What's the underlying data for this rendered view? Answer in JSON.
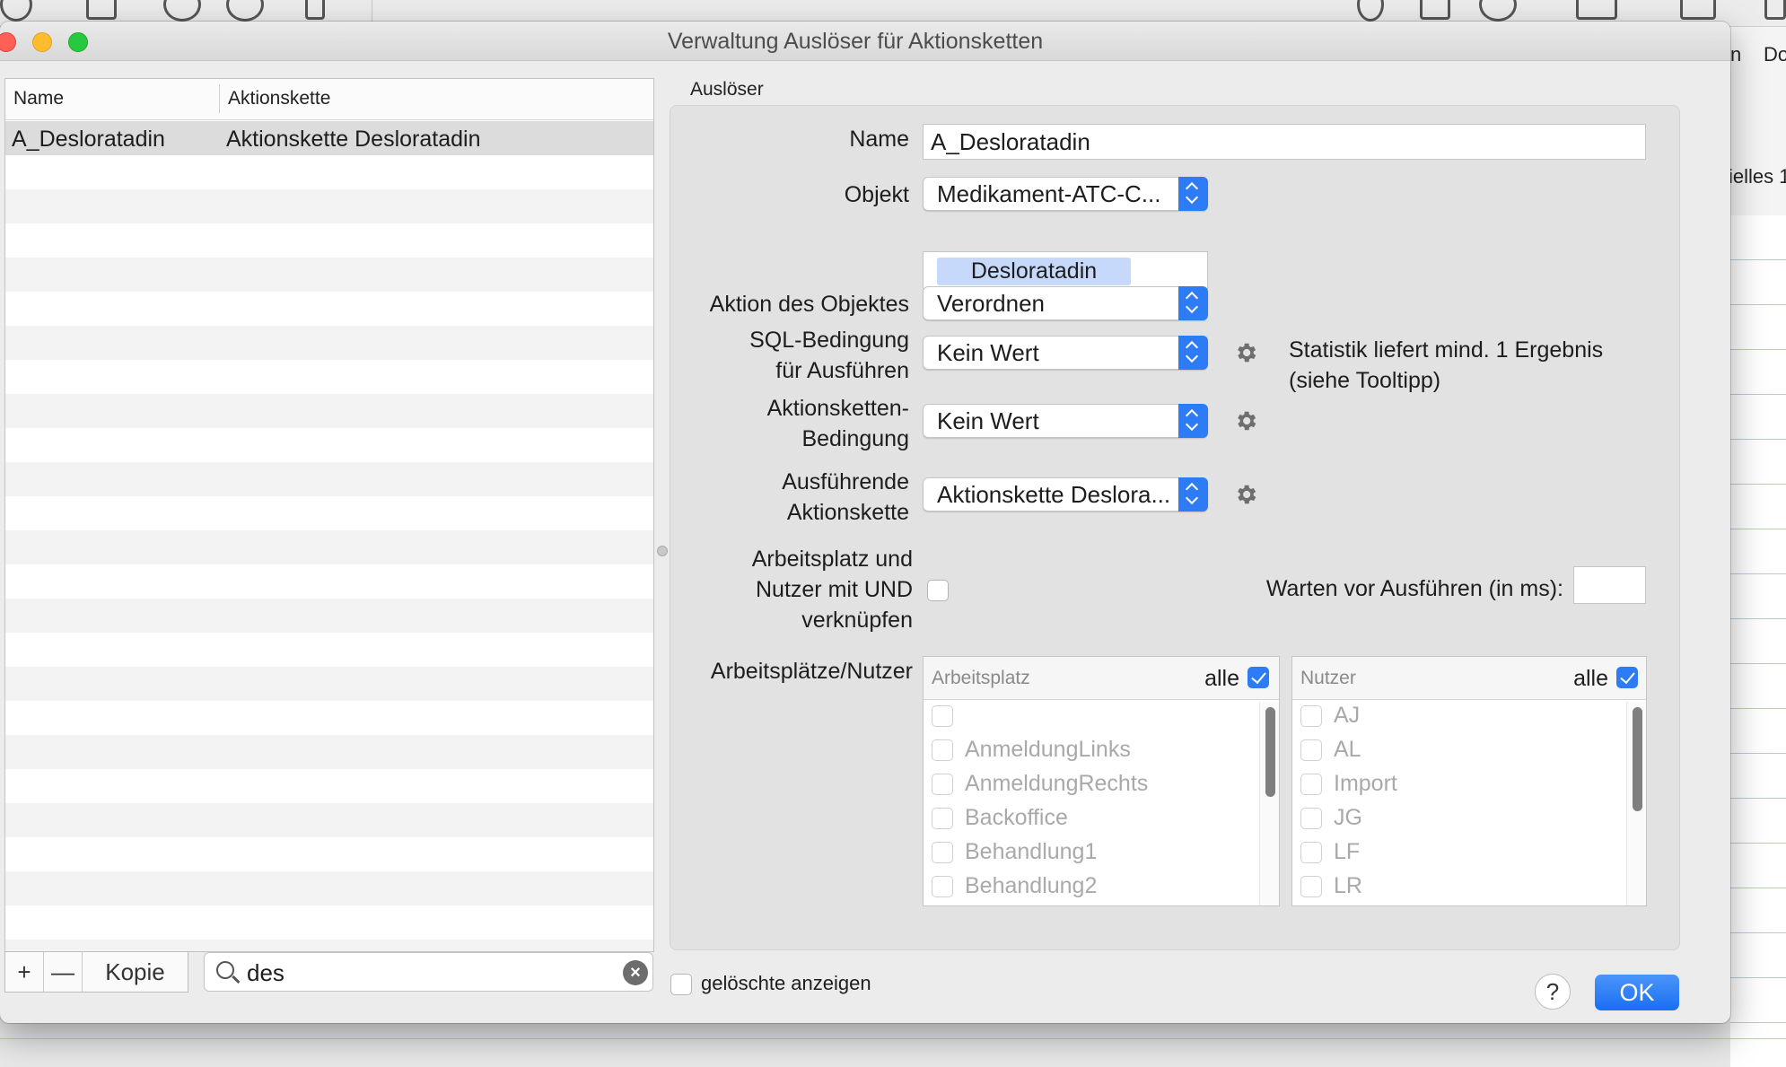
{
  "background_app": {
    "right_labels": [
      "n",
      "Do"
    ],
    "partial_label": "ielles 1"
  },
  "window": {
    "title": "Verwaltung Auslöser für Aktionsketten"
  },
  "table": {
    "columns": [
      "Name",
      "Aktionskette"
    ],
    "rows": [
      {
        "name": "A_Desloratadin",
        "chain": "Aktionskette Desloratadin",
        "selected": true
      }
    ]
  },
  "bottom_bar": {
    "add_label": "+",
    "remove_label": "—",
    "copy_label": "Kopie",
    "search_value": "des",
    "show_deleted_label": "gelöschte anzeigen",
    "show_deleted_checked": false,
    "help_label": "?",
    "ok_label": "OK"
  },
  "trigger": {
    "group_title": "Auslöser",
    "name_label": "Name",
    "name_value": "A_Desloratadin",
    "object_label": "Objekt",
    "object_value": "Medikament-ATC-C...",
    "object_token": "Desloratadin",
    "action_label": "Aktion des Objektes",
    "action_value": "Verordnen",
    "sql_label_line1": "SQL-Bedingung",
    "sql_label_line2": "für Ausführen",
    "sql_value": "Kein Wert",
    "sql_hint_line1": "Statistik liefert mind. 1 Ergebnis",
    "sql_hint_line2": "(siehe Tooltipp)",
    "chain_cond_label_line1": "Aktionsketten-",
    "chain_cond_label_line2": "Bedingung",
    "chain_cond_value": "Kein Wert",
    "exec_chain_label_line1": "Ausführende",
    "exec_chain_label_line2": "Aktionskette",
    "exec_chain_value": "Aktionskette Deslora...",
    "and_label_line1": "Arbeitsplatz und",
    "and_label_line2": "Nutzer mit UND",
    "and_label_line3": "verknüpfen",
    "and_checked": false,
    "wait_label": "Warten vor Ausführen (in ms):",
    "wait_value": "",
    "places_users_label": "Arbeitsplätze/Nutzer"
  },
  "workstations": {
    "header": "Arbeitsplatz",
    "all_label": "alle",
    "all_checked": true,
    "items": [
      "",
      "AnmeldungLinks",
      "AnmeldungRechts",
      "Backoffice",
      "Behandlung1",
      "Behandlung2"
    ]
  },
  "users": {
    "header": "Nutzer",
    "all_label": "alle",
    "all_checked": true,
    "items": [
      "AJ",
      "AL",
      "Import",
      "JG",
      "LF",
      "LR"
    ]
  },
  "colors": {
    "accent": "#2d7cf6",
    "token": "#c6d9fb",
    "close": "#fe5f57",
    "minimize": "#febc2e",
    "zoom": "#28c840"
  }
}
